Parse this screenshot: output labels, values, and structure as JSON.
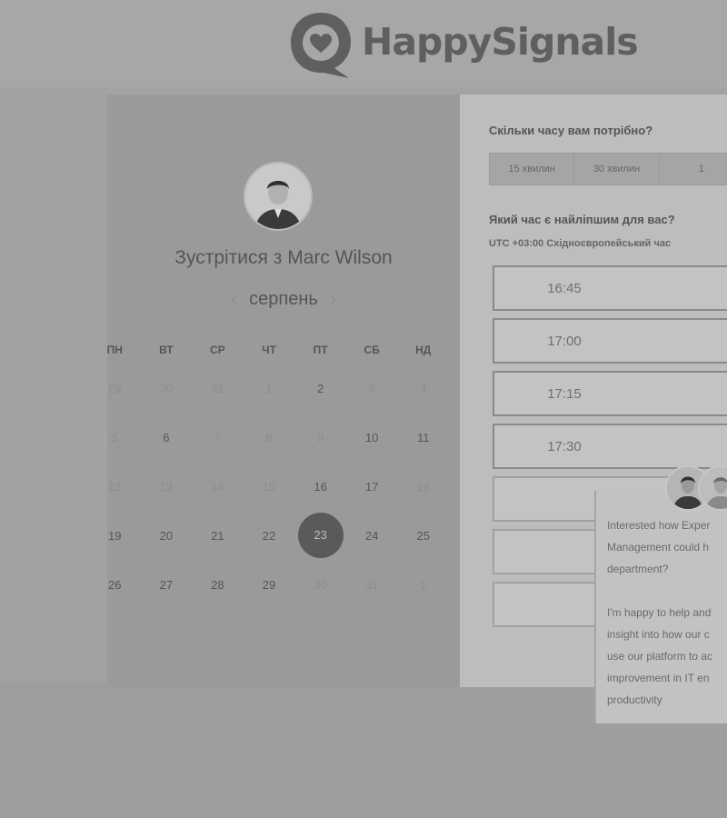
{
  "header": {
    "brand": "HappySignals"
  },
  "calendar": {
    "title": "Зустрітися з Marc Wilson",
    "month": "серпень",
    "weekdays": [
      "ПН",
      "ВТ",
      "СР",
      "ЧТ",
      "ПТ",
      "СБ",
      "НД"
    ],
    "rows": [
      [
        {
          "d": "29",
          "m": true
        },
        {
          "d": "30",
          "m": true
        },
        {
          "d": "31",
          "m": true
        },
        {
          "d": "1",
          "m": true
        },
        {
          "d": "2",
          "m": false
        },
        {
          "d": "3",
          "m": true
        },
        {
          "d": "4",
          "m": true
        }
      ],
      [
        {
          "d": "5",
          "m": true
        },
        {
          "d": "6",
          "m": false
        },
        {
          "d": "7",
          "m": true
        },
        {
          "d": "8",
          "m": true
        },
        {
          "d": "9",
          "m": true
        },
        {
          "d": "10",
          "m": false
        },
        {
          "d": "11",
          "m": false
        }
      ],
      [
        {
          "d": "12",
          "m": true
        },
        {
          "d": "13",
          "m": true
        },
        {
          "d": "14",
          "m": true
        },
        {
          "d": "15",
          "m": true
        },
        {
          "d": "16",
          "m": false
        },
        {
          "d": "17",
          "m": false
        },
        {
          "d": "18",
          "m": true
        }
      ],
      [
        {
          "d": "19",
          "m": false
        },
        {
          "d": "20",
          "m": false
        },
        {
          "d": "21",
          "m": false
        },
        {
          "d": "22",
          "m": false
        },
        {
          "d": "23",
          "m": false,
          "s": true
        },
        {
          "d": "24",
          "m": false
        },
        {
          "d": "25",
          "m": false
        }
      ],
      [
        {
          "d": "26",
          "m": false
        },
        {
          "d": "27",
          "m": false
        },
        {
          "d": "28",
          "m": false
        },
        {
          "d": "29",
          "m": false
        },
        {
          "d": "30",
          "m": true
        },
        {
          "d": "31",
          "m": true
        },
        {
          "d": "1",
          "m": true
        }
      ]
    ]
  },
  "booking": {
    "duration_question": "Скільки часу вам потрібно?",
    "durations": [
      "15 хвилин",
      "30 хвилин",
      "1"
    ],
    "time_question": "Який час є найліпшим для вас?",
    "timezone": "UTC +03:00 Східноєвропейський час",
    "slots": [
      "16:45",
      "17:00",
      "17:15",
      "17:30",
      "",
      "",
      ""
    ]
  },
  "chat": {
    "lines1": [
      "Interested how Exper",
      "Management could h",
      "department?"
    ],
    "lines2": [
      "I'm happy to help and",
      "insight into how our c",
      "use our platform to ac",
      "improvement in IT en",
      "productivity"
    ]
  }
}
